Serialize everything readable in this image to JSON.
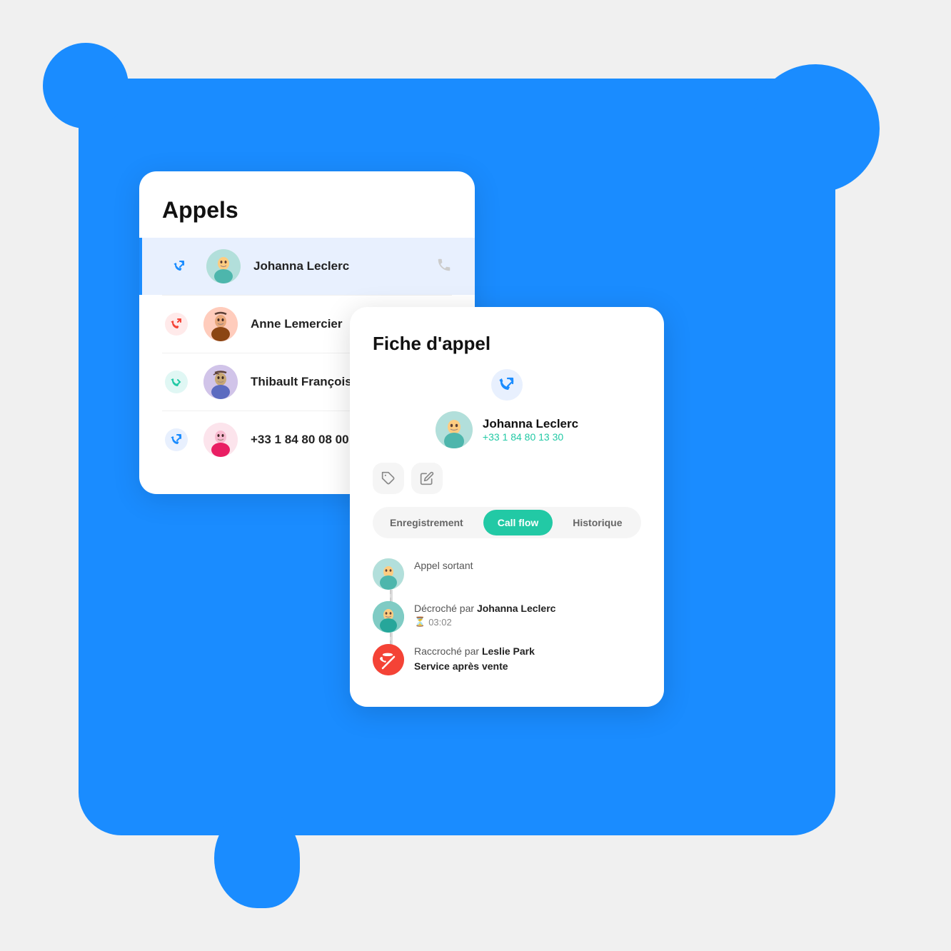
{
  "scene": {
    "background_color": "#1a8cff"
  },
  "appels_card": {
    "title": "Appels",
    "items": [
      {
        "name": "Johanna Leclerc",
        "type": "outgoing",
        "icon_color": "#1a8cff",
        "active": true,
        "avatar_type": "johanna"
      },
      {
        "name": "Anne Lemercier",
        "type": "incoming_missed",
        "icon_color": "#f44336",
        "active": false,
        "avatar_type": "anne"
      },
      {
        "name": "Thibault François",
        "type": "incoming_answered",
        "icon_color": "#22c9a5",
        "active": false,
        "avatar_type": "thibault"
      },
      {
        "name": "+33 1 84 80 08 00",
        "type": "outgoing",
        "icon_color": "#1a8cff",
        "active": false,
        "avatar_type": "unknown"
      }
    ]
  },
  "fiche_card": {
    "title": "Fiche d'appel",
    "caller": {
      "name": "Johanna Leclerc",
      "phone": "+33 1 84 80 13 30"
    },
    "tabs": [
      {
        "label": "Enregistrement",
        "active": false
      },
      {
        "label": "Call flow",
        "active": true
      },
      {
        "label": "Historique",
        "active": false
      }
    ],
    "actions": [
      {
        "icon": "🏷",
        "label": "tag-button"
      },
      {
        "icon": "✏",
        "label": "edit-button"
      }
    ],
    "flow_items": [
      {
        "type": "outgoing",
        "text": "Appel sortant",
        "avatar_color": "green"
      },
      {
        "type": "answered",
        "text": "Décroché par Johanna Leclerc",
        "time": "03:02",
        "avatar_color": "teal"
      },
      {
        "type": "hangup",
        "text": "Raccroché par Leslie Park",
        "subtext": "Service après vente",
        "avatar_color": "red"
      }
    ]
  }
}
